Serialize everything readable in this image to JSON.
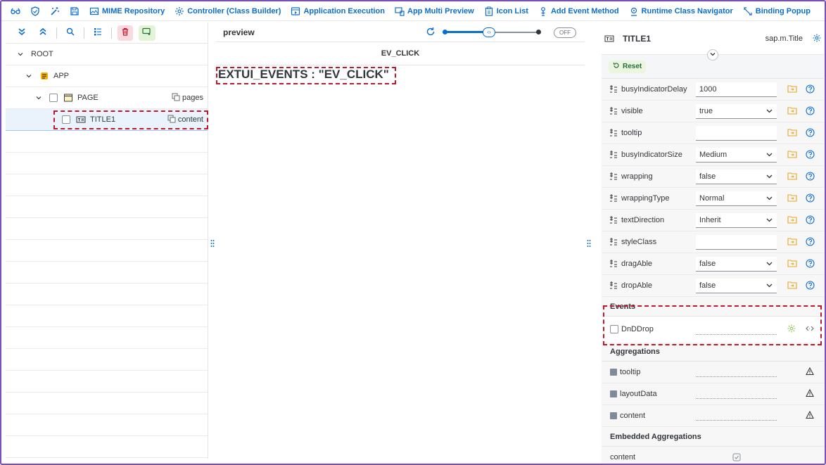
{
  "toolbar": {
    "items": [
      {
        "label": "",
        "icon": "glasses-icon"
      },
      {
        "label": "",
        "icon": "shield-icon"
      },
      {
        "label": "",
        "icon": "magic-wand-icon"
      },
      {
        "label": "",
        "icon": "save-icon"
      },
      {
        "label": "MIME Repository",
        "icon": "image-icon"
      },
      {
        "label": "Controller (Class Builder)",
        "icon": "settings-icon"
      },
      {
        "label": "Application Execution",
        "icon": "run-icon"
      },
      {
        "label": "App Multi Preview",
        "icon": "multi-preview-icon"
      },
      {
        "label": "Icon List",
        "icon": "clipboard-icon"
      },
      {
        "label": "Add Event Method",
        "icon": "add-event-icon"
      },
      {
        "label": "Runtime Class Navigator",
        "icon": "pin-icon"
      },
      {
        "label": "Binding Popup",
        "icon": "link-icon"
      }
    ],
    "accent": "#0a6ed1"
  },
  "tree": {
    "rows": [
      {
        "label": "ROOT",
        "aggregation": ""
      },
      {
        "label": "APP",
        "aggregation": ""
      },
      {
        "label": "PAGE",
        "aggregation": "pages"
      },
      {
        "label": "TITLE1",
        "aggregation": "content"
      }
    ]
  },
  "preview": {
    "title": "preview",
    "switch_label": "OFF",
    "event_bar": "EV_CLICK",
    "output_text": "EXTUI_EVENTS : \"EV_CLICK\""
  },
  "properties": {
    "control_name": "TITLE1",
    "control_type": "sap.m.Title",
    "reset_label": "Reset",
    "rows": [
      {
        "name": "busyIndicatorDelay",
        "value": "1000",
        "dropdown": false
      },
      {
        "name": "visible",
        "value": "true",
        "dropdown": true
      },
      {
        "name": "tooltip",
        "value": "",
        "dropdown": false
      },
      {
        "name": "busyIndicatorSize",
        "value": "Medium",
        "dropdown": true
      },
      {
        "name": "wrapping",
        "value": "false",
        "dropdown": true
      },
      {
        "name": "wrappingType",
        "value": "Normal",
        "dropdown": true
      },
      {
        "name": "textDirection",
        "value": "Inherit",
        "dropdown": true
      },
      {
        "name": "styleClass",
        "value": "",
        "dropdown": false
      },
      {
        "name": "dragAble",
        "value": "false",
        "dropdown": true
      },
      {
        "name": "dropAble",
        "value": "false",
        "dropdown": true
      }
    ],
    "events_title": "Events",
    "events": [
      {
        "name": "DnDDrop"
      }
    ],
    "aggregations_title": "Aggregations",
    "aggregations": [
      {
        "name": "tooltip"
      },
      {
        "name": "layoutData"
      },
      {
        "name": "content"
      }
    ],
    "embedded_title": "Embedded Aggregations",
    "embedded": [
      {
        "name": "content"
      }
    ]
  }
}
